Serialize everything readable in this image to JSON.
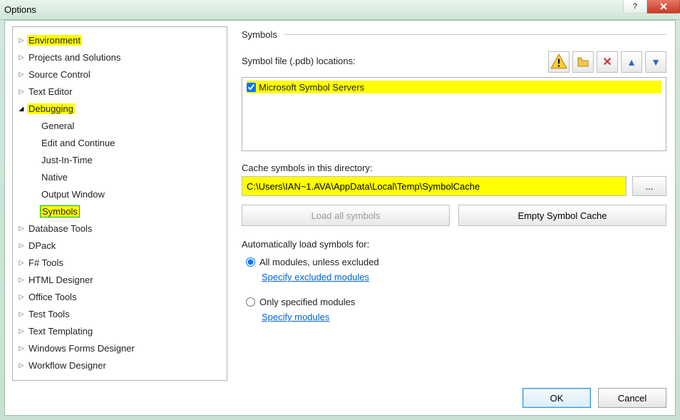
{
  "window": {
    "title": "Options"
  },
  "tree": {
    "items": [
      {
        "label": "Environment",
        "expanded": false,
        "highlight": true
      },
      {
        "label": "Projects and Solutions",
        "expanded": false
      },
      {
        "label": "Source Control",
        "expanded": false
      },
      {
        "label": "Text Editor",
        "expanded": false
      },
      {
        "label": "Debugging",
        "expanded": true,
        "highlight": true,
        "children": [
          {
            "label": "General"
          },
          {
            "label": "Edit and Continue"
          },
          {
            "label": "Just-In-Time"
          },
          {
            "label": "Native"
          },
          {
            "label": "Output Window"
          },
          {
            "label": "Symbols",
            "selected": true
          }
        ]
      },
      {
        "label": "Database Tools",
        "expanded": false
      },
      {
        "label": "DPack",
        "expanded": false
      },
      {
        "label": "F# Tools",
        "expanded": false
      },
      {
        "label": "HTML Designer",
        "expanded": false
      },
      {
        "label": "Office Tools",
        "expanded": false
      },
      {
        "label": "Test Tools",
        "expanded": false
      },
      {
        "label": "Text Templating",
        "expanded": false
      },
      {
        "label": "Windows Forms Designer",
        "expanded": false
      },
      {
        "label": "Workflow Designer",
        "expanded": false
      }
    ]
  },
  "panel": {
    "heading": "Symbols",
    "locations_label": "Symbol file (.pdb) locations:",
    "symbol_servers_label": "Microsoft Symbol Servers",
    "cache_label": "Cache symbols in this directory:",
    "cache_path": "C:\\Users\\IAN~1.AVA\\AppData\\Local\\Temp\\SymbolCache",
    "browse_label": "...",
    "load_all_label": "Load all symbols",
    "empty_cache_label": "Empty Symbol Cache",
    "auto_label": "Automatically load symbols for:",
    "radio_all_label": "All modules, unless excluded",
    "link_excluded": "Specify excluded modules",
    "radio_only_label": "Only specified modules",
    "link_modules": "Specify modules"
  },
  "footer": {
    "ok_label": "OK",
    "cancel_label": "Cancel"
  }
}
